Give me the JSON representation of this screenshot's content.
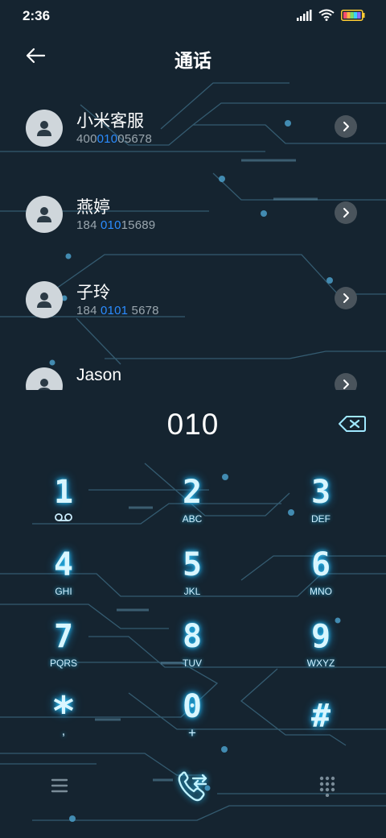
{
  "status": {
    "time": "2:36"
  },
  "header": {
    "title": "通话"
  },
  "contacts": [
    {
      "name": "小米客服",
      "number_parts": [
        "400",
        "010",
        "05678"
      ]
    },
    {
      "name": "燕婷",
      "number_parts": [
        "184 ",
        "010",
        "15689"
      ]
    },
    {
      "name": "子玲",
      "number_parts": [
        "184 ",
        "0101",
        " 5678"
      ]
    },
    {
      "name": "Jason",
      "number_parts": [
        "",
        "",
        ""
      ]
    }
  ],
  "dialer": {
    "number": "010"
  },
  "keypad": [
    {
      "digit": "1",
      "letters": ""
    },
    {
      "digit": "2",
      "letters": "ABC"
    },
    {
      "digit": "3",
      "letters": "DEF"
    },
    {
      "digit": "4",
      "letters": "GHI"
    },
    {
      "digit": "5",
      "letters": "JKL"
    },
    {
      "digit": "6",
      "letters": "MNO"
    },
    {
      "digit": "7",
      "letters": "PQRS"
    },
    {
      "digit": "8",
      "letters": "TUV"
    },
    {
      "digit": "9",
      "letters": "WXYZ"
    },
    {
      "digit": "*",
      "letters": ","
    },
    {
      "digit": "0",
      "letters": "+"
    },
    {
      "digit": "#",
      "letters": ""
    }
  ],
  "colors": {
    "background": "#152430",
    "highlight": "#2b8cff",
    "glow": "#28c8ff",
    "circuit": "#3f6e86"
  },
  "icons": {
    "back": "arrow-left-icon",
    "avatar": "person-icon",
    "chevron": "chevron-right-icon",
    "backspace": "backspace-icon",
    "voicemail": "voicemail-icon",
    "menu": "menu-icon",
    "call": "phone-call-icon",
    "dialpad": "dialpad-icon"
  }
}
